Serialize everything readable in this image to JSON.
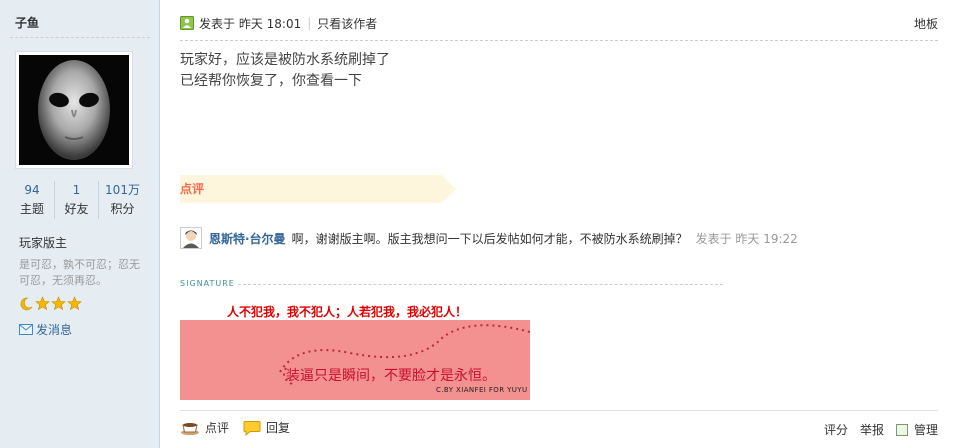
{
  "author": {
    "name": "子鱼",
    "stats": [
      {
        "value": "94",
        "label": "主题"
      },
      {
        "value": "1",
        "label": "好友"
      },
      {
        "value": "101万",
        "label": "积分"
      }
    ],
    "rank": "玩家版主",
    "motto": "是可忍，孰不可忍；忍无可忍，无须再忍。",
    "send_message": "发消息"
  },
  "post": {
    "posted_at": "发表于 昨天 18:01",
    "author_only": "只看该作者",
    "floor": "地板",
    "body_line1": "玩家好，应该是被防水系统刷掉了",
    "body_line2": "已经帮你恢复了，你查看一下"
  },
  "comments": {
    "header": "点评",
    "item": {
      "user": "恩斯特·台尔曼",
      "text": "啊，谢谢版主啊。版主我想问一下以后发帖如何才能，不被防水系统刷掉？",
      "time": "发表于 昨天 19:22"
    }
  },
  "signature": {
    "label": "SIGNATURE",
    "text": "人不犯我，我不犯人；人若犯我，我必犯人！",
    "image_text": "装逼只是瞬间，不要脸才是永恒。",
    "image_credit": "C.BY XIANFEI FOR YUYU"
  },
  "actions": {
    "comment": "点评",
    "reply": "回复",
    "rate": "评分",
    "report": "举报",
    "manage": "管理"
  },
  "colors": {
    "sidebar_bg": "#e5edf2",
    "link": "#336699",
    "comment_header": "#f26c4f",
    "signature_red": "#e00000",
    "signature_image_bg": "#f39190"
  }
}
